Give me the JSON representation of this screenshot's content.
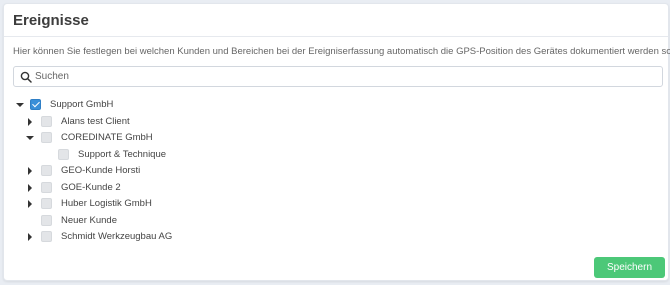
{
  "header": {
    "title": "Ereignisse"
  },
  "description": "Hier können Sie festlegen bei welchen Kunden und Bereichen bei der Ereigniserfassung automatisch die GPS-Position des Gerätes dokumentiert werden soll.",
  "search": {
    "placeholder": "Suchen",
    "value": ""
  },
  "tree": {
    "root": {
      "label": "Support GmbH",
      "checked": true,
      "expanded": true
    },
    "items": [
      {
        "label": "Alans test Client",
        "checked": false,
        "expanded": false
      },
      {
        "label": "COREDINATE GmbH",
        "checked": false,
        "expanded": true
      },
      {
        "label": "Support & Technique",
        "checked": false
      },
      {
        "label": "GEO-Kunde Horsti",
        "checked": false,
        "expanded": false
      },
      {
        "label": "GOE-Kunde 2",
        "checked": false,
        "expanded": false
      },
      {
        "label": "Huber Logistik GmbH",
        "checked": false,
        "expanded": false
      },
      {
        "label": "Neuer Kunde",
        "checked": false
      },
      {
        "label": "Schmidt Werkzeugbau AG",
        "checked": false,
        "expanded": false
      }
    ]
  },
  "footer": {
    "save_label": "Speichern"
  },
  "colors": {
    "accent": "#3a8fd8",
    "save": "#4cc878"
  }
}
